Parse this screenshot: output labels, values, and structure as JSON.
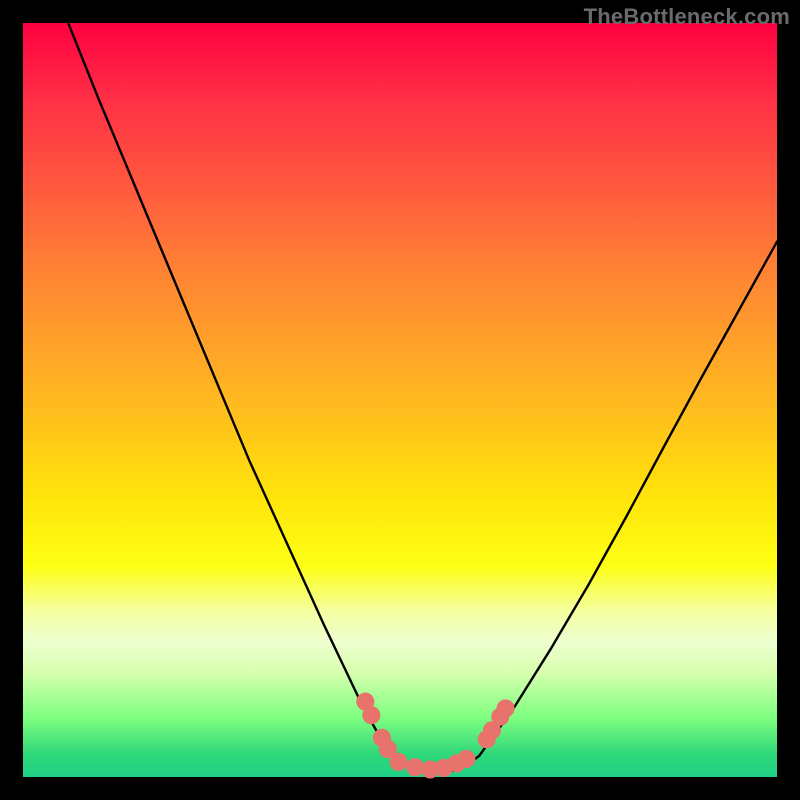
{
  "watermark": "TheBottleneck.com",
  "chart_data": {
    "type": "line",
    "title": "",
    "xlabel": "",
    "ylabel": "",
    "xlim": [
      0,
      1
    ],
    "ylim": [
      0,
      1
    ],
    "gradient_stops": [
      {
        "pos": 0.0,
        "color": "#ff0040"
      },
      {
        "pos": 0.1,
        "color": "#ff2f46"
      },
      {
        "pos": 0.22,
        "color": "#ff5a3e"
      },
      {
        "pos": 0.35,
        "color": "#ff8a32"
      },
      {
        "pos": 0.5,
        "color": "#ffb820"
      },
      {
        "pos": 0.63,
        "color": "#ffe40a"
      },
      {
        "pos": 0.72,
        "color": "#fdff15"
      },
      {
        "pos": 0.78,
        "color": "#f5ffa0"
      },
      {
        "pos": 0.82,
        "color": "#eeffd0"
      },
      {
        "pos": 0.86,
        "color": "#d9ffb0"
      },
      {
        "pos": 0.92,
        "color": "#7fff80"
      },
      {
        "pos": 0.97,
        "color": "#2fd87a"
      },
      {
        "pos": 1.0,
        "color": "#1fcf86"
      }
    ],
    "series": [
      {
        "name": "left-branch",
        "x": [
          0.06,
          0.1,
          0.15,
          0.2,
          0.25,
          0.3,
          0.35,
          0.4,
          0.45,
          0.475,
          0.49
        ],
        "y": [
          1.0,
          0.9,
          0.78,
          0.66,
          0.54,
          0.42,
          0.31,
          0.2,
          0.095,
          0.05,
          0.032
        ]
      },
      {
        "name": "trough",
        "x": [
          0.49,
          0.52,
          0.55,
          0.58,
          0.605
        ],
        "y": [
          0.032,
          0.01,
          0.005,
          0.01,
          0.028
        ]
      },
      {
        "name": "right-branch",
        "x": [
          0.605,
          0.65,
          0.7,
          0.75,
          0.8,
          0.85,
          0.9,
          0.95,
          1.0
        ],
        "y": [
          0.028,
          0.09,
          0.17,
          0.255,
          0.345,
          0.438,
          0.53,
          0.62,
          0.71
        ]
      }
    ],
    "markers": {
      "name": "highlighted-points",
      "color": "#e8736d",
      "radius_frac": 0.012,
      "points": [
        {
          "x": 0.454,
          "y": 0.1
        },
        {
          "x": 0.462,
          "y": 0.082
        },
        {
          "x": 0.476,
          "y": 0.052
        },
        {
          "x": 0.484,
          "y": 0.037
        },
        {
          "x": 0.498,
          "y": 0.02
        },
        {
          "x": 0.52,
          "y": 0.013
        },
        {
          "x": 0.54,
          "y": 0.01
        },
        {
          "x": 0.558,
          "y": 0.012
        },
        {
          "x": 0.575,
          "y": 0.018
        },
        {
          "x": 0.588,
          "y": 0.024
        },
        {
          "x": 0.615,
          "y": 0.05
        },
        {
          "x": 0.622,
          "y": 0.062
        },
        {
          "x": 0.633,
          "y": 0.08
        },
        {
          "x": 0.64,
          "y": 0.091
        }
      ]
    }
  }
}
